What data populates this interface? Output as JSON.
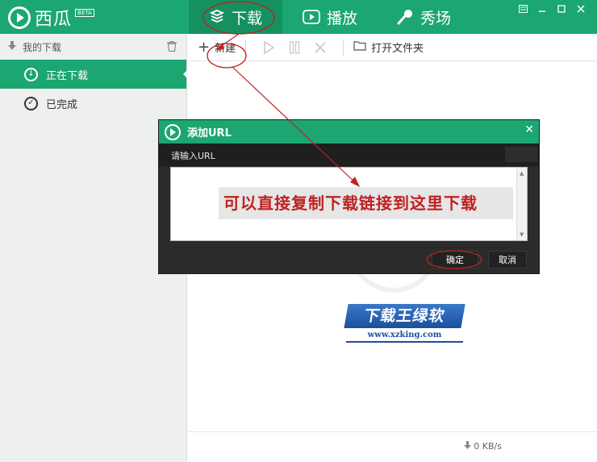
{
  "app": {
    "title": "西瓜",
    "badge": "BETA"
  },
  "nav": {
    "tabs": [
      {
        "label": "下载",
        "icon": "download-box-icon",
        "active": true
      },
      {
        "label": "播放",
        "icon": "play-icon",
        "active": false
      },
      {
        "label": "秀场",
        "icon": "microphone-icon",
        "active": false
      }
    ]
  },
  "window_controls": {
    "menu": "menu-icon",
    "minimize": "minimize-icon",
    "maximize": "maximize-icon",
    "close": "close-icon"
  },
  "sidebar": {
    "header": "我的下载",
    "items": [
      {
        "label": "正在下载",
        "icon": "download-circle-icon",
        "active": true
      },
      {
        "label": "已完成",
        "icon": "check-circle-icon",
        "active": false
      }
    ]
  },
  "toolbar": {
    "new_label": "新建",
    "open_folder_label": "打开文件夹"
  },
  "watermark": {
    "title": "下载王绿软",
    "url": "www.xzking.com"
  },
  "status": {
    "speed": "0 KB/s"
  },
  "dialog": {
    "title": "添加URL",
    "prompt": "请输入URL",
    "hint": "可以直接复制下载链接到这里下载",
    "ok_label": "确定",
    "cancel_label": "取消"
  },
  "colors": {
    "brand_green": "#1ba672",
    "active_tab": "#15915f",
    "annotation_red": "#c0201f",
    "watermark_blue": "#1c4f9c"
  }
}
